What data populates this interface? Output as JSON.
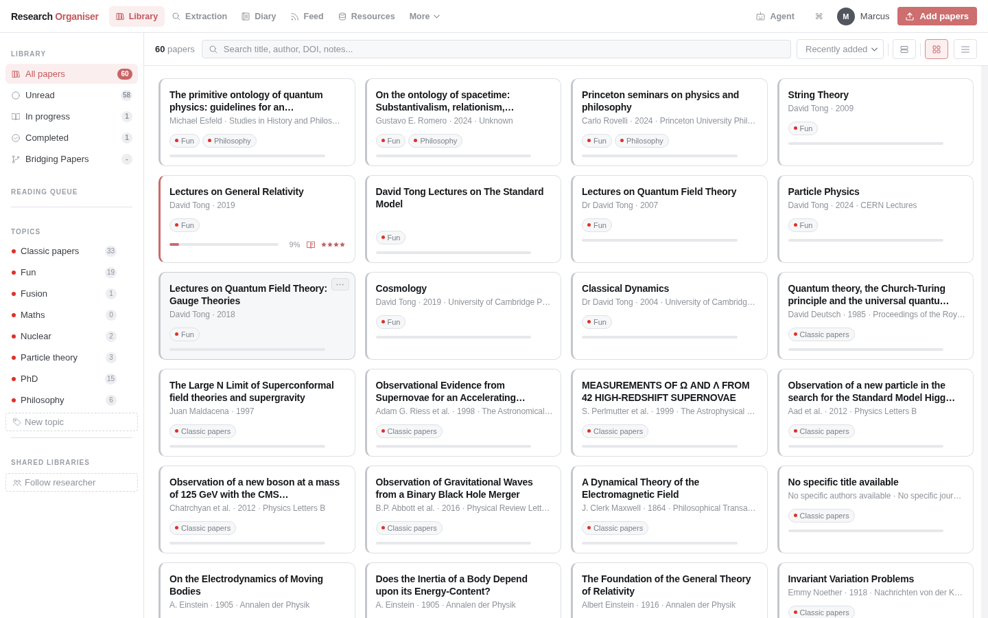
{
  "brand": {
    "name": "Research",
    "accent": "Organiser"
  },
  "nav": {
    "tabs": [
      {
        "label": "Library",
        "selected": true
      },
      {
        "label": "Extraction",
        "selected": false
      },
      {
        "label": "Diary",
        "selected": false
      },
      {
        "label": "Feed",
        "selected": false
      },
      {
        "label": "Resources",
        "selected": false
      }
    ],
    "more": {
      "label": "More"
    }
  },
  "header_actions": {
    "agent": {
      "label": "Agent"
    },
    "shortcut": {
      "label": "⌘"
    },
    "user": {
      "initial": "M",
      "name": "Marcus"
    },
    "add_button": {
      "label": "Add papers"
    }
  },
  "sidebar": {
    "library": {
      "heading": "LIBRARY",
      "items": [
        {
          "label": "All papers",
          "count": "60",
          "selected": true
        },
        {
          "label": "Unread",
          "count": "58",
          "selected": false
        },
        {
          "label": "In progress",
          "count": "1",
          "selected": false
        },
        {
          "label": "Completed",
          "count": "1",
          "selected": false
        },
        {
          "label": "Bridging Papers",
          "count": "-",
          "selected": false
        }
      ]
    },
    "reading_queue": {
      "heading": "READING QUEUE"
    },
    "topics": {
      "heading": "TOPICS",
      "items": [
        {
          "label": "Classic papers",
          "count": "33",
          "color": "#e0302a"
        },
        {
          "label": "Fun",
          "count": "19",
          "color": "#e0302a"
        },
        {
          "label": "Fusion",
          "count": "1",
          "color": "#e0302a"
        },
        {
          "label": "Maths",
          "count": "0",
          "color": "#e0302a"
        },
        {
          "label": "Nuclear",
          "count": "2",
          "color": "#e0302a"
        },
        {
          "label": "Particle theory",
          "count": "3",
          "color": "#e0302a"
        },
        {
          "label": "PhD",
          "count": "15",
          "color": "#e0302a"
        },
        {
          "label": "Philosophy",
          "count": "6",
          "color": "#e0302a"
        }
      ],
      "new_button": "New topic"
    },
    "shared": {
      "heading": "SHARED LIBRARIES",
      "follow_button": "Follow researcher"
    }
  },
  "toolbar": {
    "count": "**60** papers",
    "search": {
      "placeholder": "Search title, author, DOI, notes..."
    },
    "sort": {
      "value": "Recently added"
    },
    "views": [
      {
        "selected": false
      },
      {
        "selected": true
      },
      {
        "selected": false
      }
    ]
  },
  "papers": [
    {
      "title": "The primitive ontology of quantum physics: guidelines for an…",
      "meta": "Michael Esfeld · Studies in History and Philos…",
      "tags": [
        {
          "label": "Fun",
          "color": "#e0302a"
        },
        {
          "label": "Philosophy",
          "color": "#e0302a"
        }
      ],
      "progress_bar": true,
      "in_progress": false,
      "hovered": false
    },
    {
      "title": "On the ontology of spacetime: Substantivalism, relationism,…",
      "meta": "Gustavo E. Romero · 2024 · Unknown",
      "tags": [
        {
          "label": "Fun",
          "color": "#e0302a"
        },
        {
          "label": "Philosophy",
          "color": "#e0302a"
        }
      ],
      "progress_bar": true,
      "in_progress": false,
      "hovered": false
    },
    {
      "title": "Princeton seminars on physics and philosophy",
      "meta": "Carlo Rovelli · 2024 · Princeton University Phil…",
      "tags": [
        {
          "label": "Fun",
          "color": "#e0302a"
        },
        {
          "label": "Philosophy",
          "color": "#e0302a"
        }
      ],
      "progress_bar": true,
      "in_progress": false,
      "hovered": false
    },
    {
      "title": "String Theory",
      "meta": "David Tong · 2009",
      "tags": [
        {
          "label": "Fun",
          "color": "#e0302a"
        }
      ],
      "progress_bar": true,
      "in_progress": false,
      "hovered": false
    },
    {
      "title": "Lectures on General Relativity",
      "meta": "David Tong · 2019",
      "tags": [
        {
          "label": "Fun",
          "color": "#e0302a"
        }
      ],
      "progress_bar": true,
      "level": 0.09,
      "progress_label": "9%",
      "stars": 4,
      "in_progress": true,
      "hovered": false
    },
    {
      "title": "David Tong Lectures on The Standard Model",
      "tags": [
        {
          "label": "Fun",
          "color": "#e0302a"
        }
      ],
      "progress_bar": true,
      "in_progress": false,
      "hovered": false
    },
    {
      "title": "Lectures on Quantum Field Theory",
      "meta": "Dr David Tong · 2007",
      "tags": [
        {
          "label": "Fun",
          "color": "#e0302a"
        }
      ],
      "progress_bar": true,
      "in_progress": false,
      "hovered": false
    },
    {
      "title": "Particle Physics",
      "meta": "David Tong · 2024 · CERN Lectures",
      "tags": [
        {
          "label": "Fun",
          "color": "#e0302a"
        }
      ],
      "progress_bar": true,
      "in_progress": false,
      "hovered": false
    },
    {
      "title": "Lectures on Quantum Field Theory: Gauge Theories",
      "meta": "David Tong · 2018",
      "tags": [
        {
          "label": "Fun",
          "color": "#e0302a"
        }
      ],
      "progress_bar": true,
      "in_progress": false,
      "hovered": true
    },
    {
      "title": "Cosmology",
      "meta": "David Tong · 2019 · University of Cambridge P…",
      "tags": [
        {
          "label": "Fun",
          "color": "#e0302a"
        }
      ],
      "progress_bar": true,
      "in_progress": false,
      "hovered": false
    },
    {
      "title": "Classical Dynamics",
      "meta": "Dr David Tong · 2004 · University of Cambridg…",
      "tags": [
        {
          "label": "Fun",
          "color": "#e0302a"
        }
      ],
      "progress_bar": true,
      "in_progress": false,
      "hovered": false
    },
    {
      "title": "Quantum theory, the Church-Turing principle and the universal quantu…",
      "meta": "David Deutsch · 1985 · Proceedings of the Roy…",
      "tags": [
        {
          "label": "Classic papers",
          "color": "#e0302a"
        }
      ],
      "progress_bar": true,
      "in_progress": false,
      "hovered": false
    },
    {
      "title": "The Large N Limit of Superconformal field theories and supergravity",
      "meta": "Juan Maldacena · 1997",
      "tags": [
        {
          "label": "Classic papers",
          "color": "#e0302a"
        }
      ],
      "progress_bar": true,
      "in_progress": false,
      "hovered": false
    },
    {
      "title": "Observational Evidence from Supernovae for an Accelerating…",
      "meta": "Adam G. Riess et al. · 1998 · The Astronomical…",
      "tags": [
        {
          "label": "Classic papers",
          "color": "#e0302a"
        }
      ],
      "progress_bar": true,
      "in_progress": false,
      "hovered": false
    },
    {
      "title": "MEASUREMENTS OF Ω AND Λ FROM 42 HIGH-REDSHIFT SUPERNOVAE",
      "meta": "S. Perlmutter et al. · 1999 · The Astrophysical …",
      "tags": [
        {
          "label": "Classic papers",
          "color": "#e0302a"
        }
      ],
      "progress_bar": true,
      "in_progress": false,
      "hovered": false
    },
    {
      "title": "Observation of a new particle in the search for the Standard Model Higg…",
      "meta": "Aad et al. · 2012 · Physics Letters B",
      "tags": [
        {
          "label": "Classic papers",
          "color": "#e0302a"
        }
      ],
      "progress_bar": true,
      "in_progress": false,
      "hovered": false
    },
    {
      "title": "Observation of a new boson at a mass of 125 GeV with the CMS…",
      "meta": "Chatrchyan et al. · 2012 · Physics Letters B",
      "tags": [
        {
          "label": "Classic papers",
          "color": "#e0302a"
        }
      ],
      "progress_bar": true,
      "in_progress": false,
      "hovered": false
    },
    {
      "title": "Observation of Gravitational Waves from a Binary Black Hole Merger",
      "meta": "B.P. Abbott et al. · 2016 · Physical Review Lett…",
      "tags": [
        {
          "label": "Classic papers",
          "color": "#e0302a"
        }
      ],
      "progress_bar": true,
      "in_progress": false,
      "hovered": false
    },
    {
      "title": "A Dynamical Theory of the Electromagnetic Field",
      "meta": "J. Clerk Maxwell · 1864 · Philosophical Transa…",
      "tags": [
        {
          "label": "Classic papers",
          "color": "#e0302a"
        }
      ],
      "progress_bar": true,
      "in_progress": false,
      "hovered": false
    },
    {
      "title": "No specific title available",
      "meta": "No specific authors available · No specific jour…",
      "tags": [
        {
          "label": "Classic papers",
          "color": "#e0302a"
        }
      ],
      "progress_bar": true,
      "in_progress": false,
      "hovered": false
    },
    {
      "title": "On the Electrodynamics of Moving Bodies",
      "meta": "A. Einstein · 1905 · Annalen der Physik",
      "in_progress": false,
      "hovered": false
    },
    {
      "title": "Does the Inertia of a Body Depend upon its Energy-Content?",
      "meta": "A. Einstein · 1905 · Annalen der Physik",
      "in_progress": false,
      "hovered": false
    },
    {
      "title": "The Foundation of the General Theory of Relativity",
      "meta": "Albert Einstein · 1916 · Annalen der Physik",
      "in_progress": false,
      "hovered": false
    },
    {
      "title": "Invariant Variation Problems",
      "meta": "Emmy Noether · 1918 · Nachrichten von der K…",
      "tags": [
        {
          "label": "Classic papers",
          "color": "#e0302a"
        }
      ],
      "in_progress": false,
      "hovered": false
    }
  ]
}
